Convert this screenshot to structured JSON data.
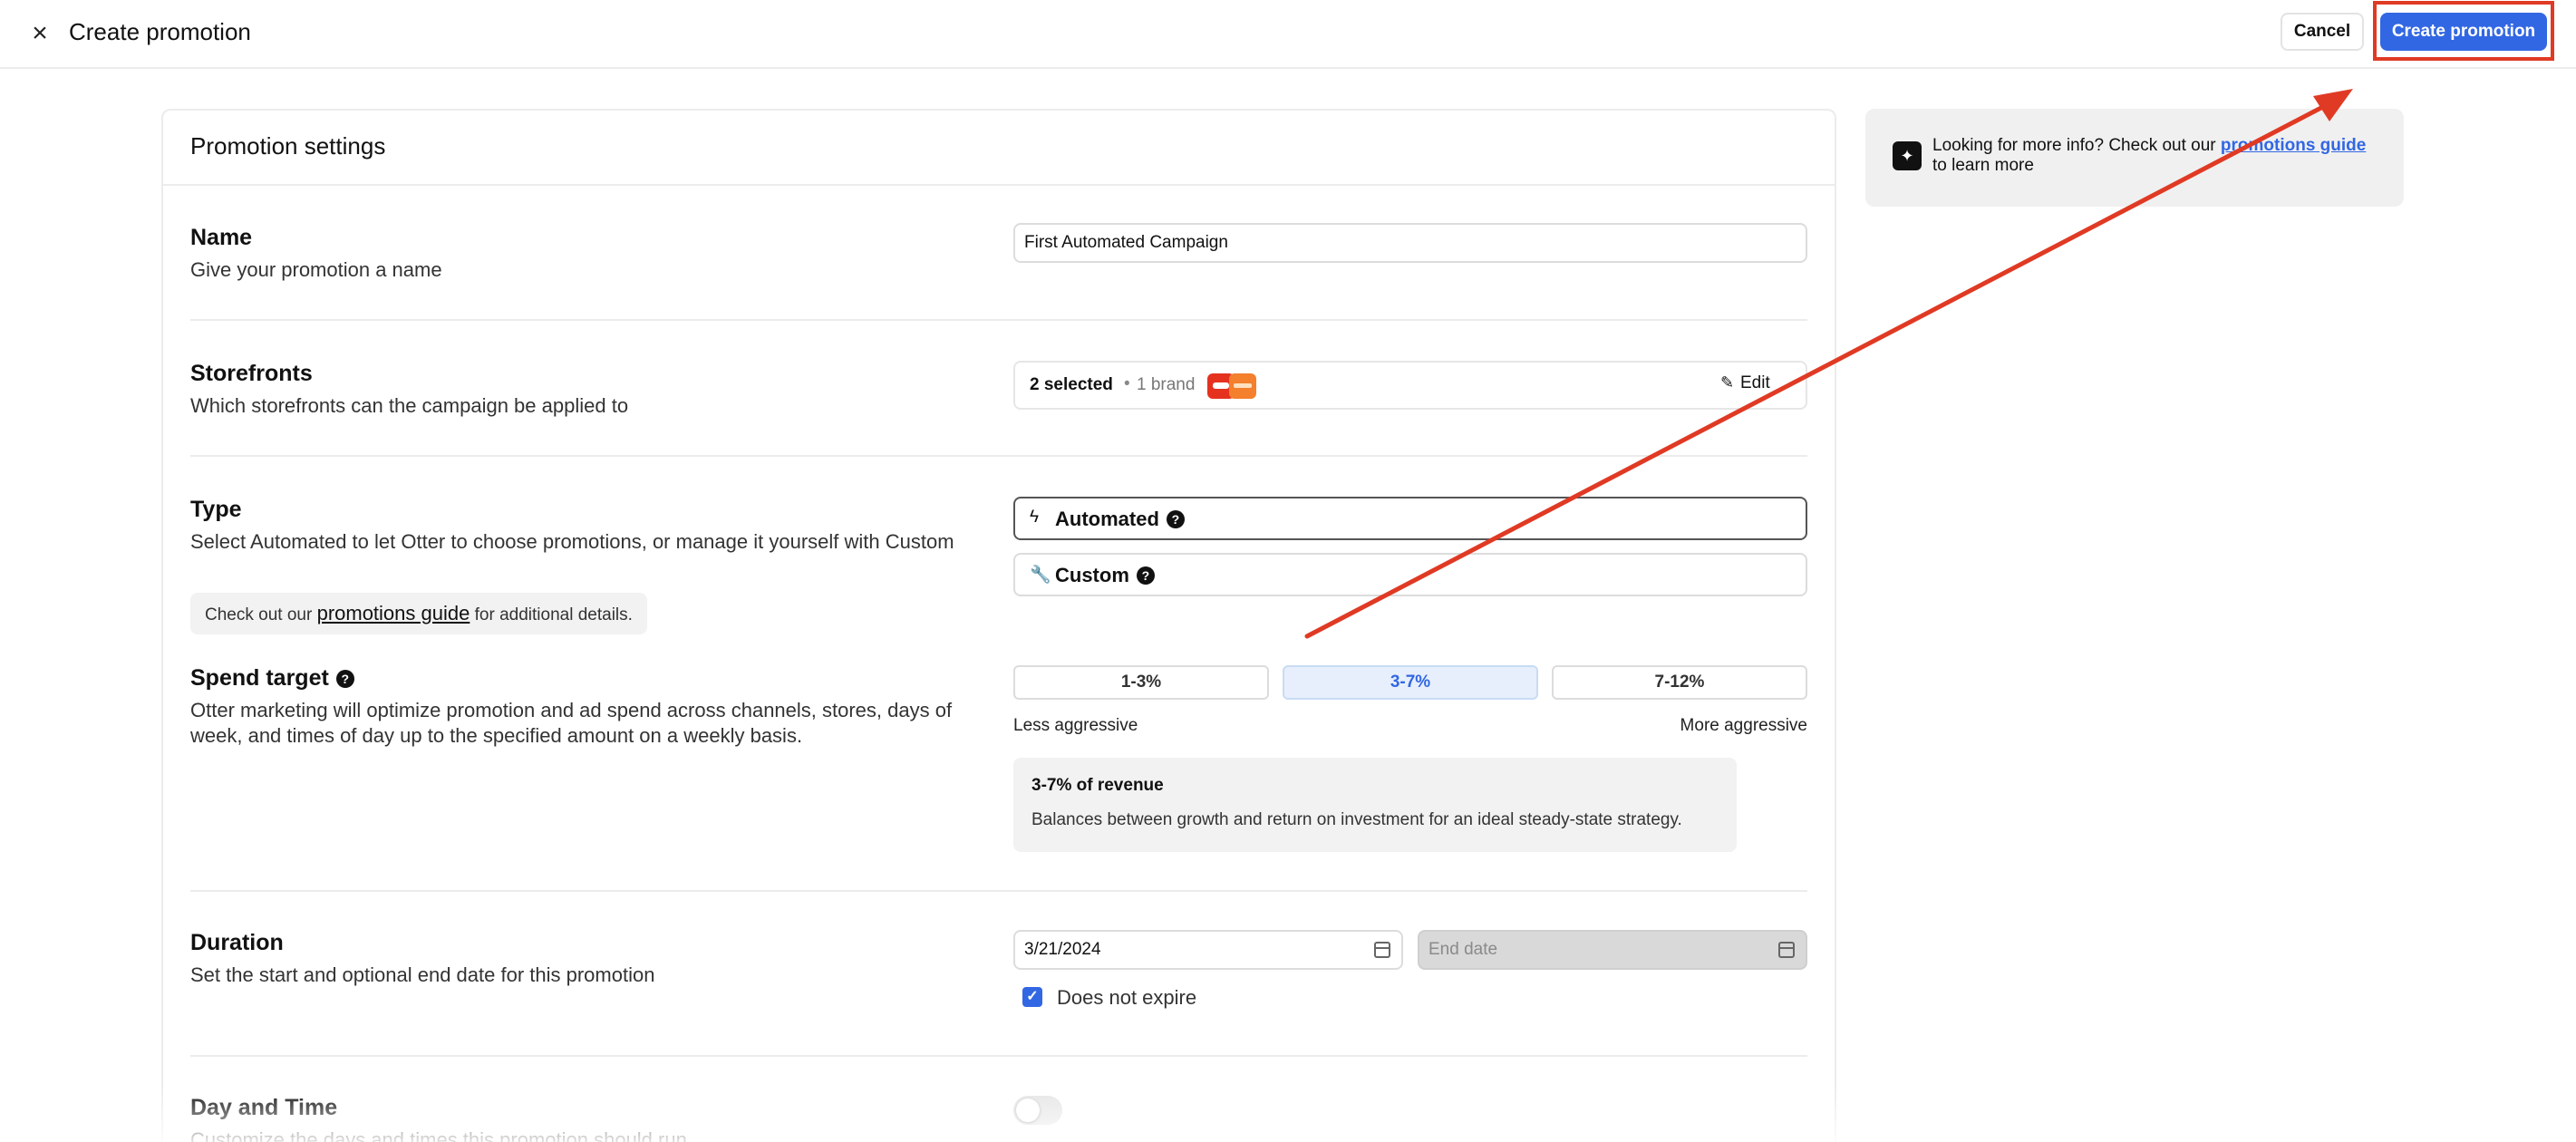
{
  "header": {
    "close_icon": "close-icon",
    "title": "Create promotion",
    "cancel_label": "Cancel",
    "create_label": "Create promotion"
  },
  "card": {
    "title": "Promotion settings"
  },
  "name": {
    "label": "Name",
    "description": "Give your promotion a name",
    "value": "First Automated Campaign"
  },
  "storefronts": {
    "label": "Storefronts",
    "description": "Which storefronts can the campaign be applied to",
    "selected": "2 selected",
    "bullet": "•",
    "brand": "1 brand",
    "edit_label": "Edit"
  },
  "type": {
    "label": "Type",
    "description": "Select Automated to let Otter to choose promotions, or manage it yourself with Custom",
    "options": [
      {
        "label": "Automated",
        "icon": "bolt-icon",
        "selected": true
      },
      {
        "label": "Custom",
        "icon": "wrench-icon",
        "selected": false
      }
    ],
    "guide_prefix": "Check out our",
    "guide_link": "promotions guide",
    "guide_suffix": "for additional details."
  },
  "spend": {
    "label": "Spend target",
    "description": "Otter marketing will optimize promotion and ad spend across channels, stores, days of week, and times of day up to the specified amount on a weekly basis.",
    "options": [
      "1-3%",
      "3-7%",
      "7-12%"
    ],
    "selected": "3-7%",
    "less": "Less aggressive",
    "more": "More aggressive",
    "info_title": "3-7% of revenue",
    "info_text": "Balances between growth and return on investment for an ideal steady-state strategy."
  },
  "duration": {
    "label": "Duration",
    "description": "Set the start and optional end date for this promotion",
    "start_value": "3/21/2024",
    "end_placeholder": "End date",
    "no_expire_label": "Does not expire",
    "no_expire_checked": true
  },
  "daytime": {
    "label": "Day and Time",
    "description": "Customize the days and times this promotion should run",
    "enabled": false
  },
  "side": {
    "text_prefix": "Looking for more info? Check out our",
    "link": "promotions guide",
    "text_suffix": "to learn more"
  },
  "colors": {
    "accent": "#3267e3",
    "annotation": "#e03a24"
  }
}
